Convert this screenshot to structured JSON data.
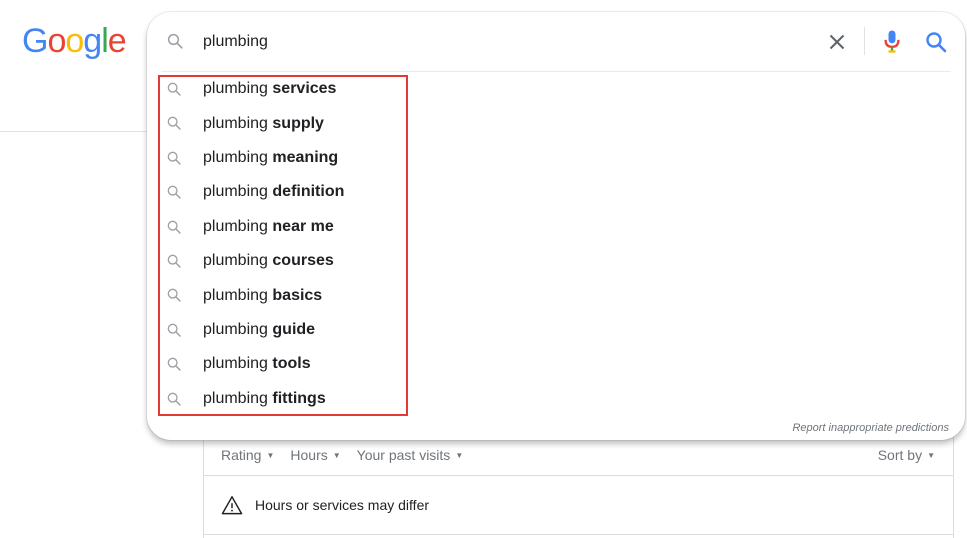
{
  "logo": {
    "letters": [
      "G",
      "o",
      "o",
      "g",
      "l",
      "e"
    ],
    "colors": [
      "#4285F4",
      "#EA4335",
      "#FBBC05",
      "#4285F4",
      "#34A853",
      "#EA4335"
    ]
  },
  "search": {
    "query": "plumbing",
    "clear_icon": "close-icon",
    "mic_icon": "microphone-icon",
    "search_icon": "search-icon"
  },
  "suggestions": [
    {
      "prefix": "plumbing",
      "completion": "services"
    },
    {
      "prefix": "plumbing",
      "completion": "supply"
    },
    {
      "prefix": "plumbing",
      "completion": "meaning"
    },
    {
      "prefix": "plumbing",
      "completion": "definition"
    },
    {
      "prefix": "plumbing",
      "completion": "near me"
    },
    {
      "prefix": "plumbing",
      "completion": "courses"
    },
    {
      "prefix": "plumbing",
      "completion": "basics"
    },
    {
      "prefix": "plumbing",
      "completion": "guide"
    },
    {
      "prefix": "plumbing",
      "completion": "tools"
    },
    {
      "prefix": "plumbing",
      "completion": "fittings"
    }
  ],
  "report_link": "Report inappropriate predictions",
  "filters": {
    "items": [
      "Rating",
      "Hours",
      "Your past visits"
    ],
    "sort_by": "Sort by"
  },
  "notice": {
    "text": "Hours or services may differ",
    "icon": "warning-icon"
  },
  "colors": {
    "highlight": "#e53935",
    "accent": "#4285F4"
  }
}
